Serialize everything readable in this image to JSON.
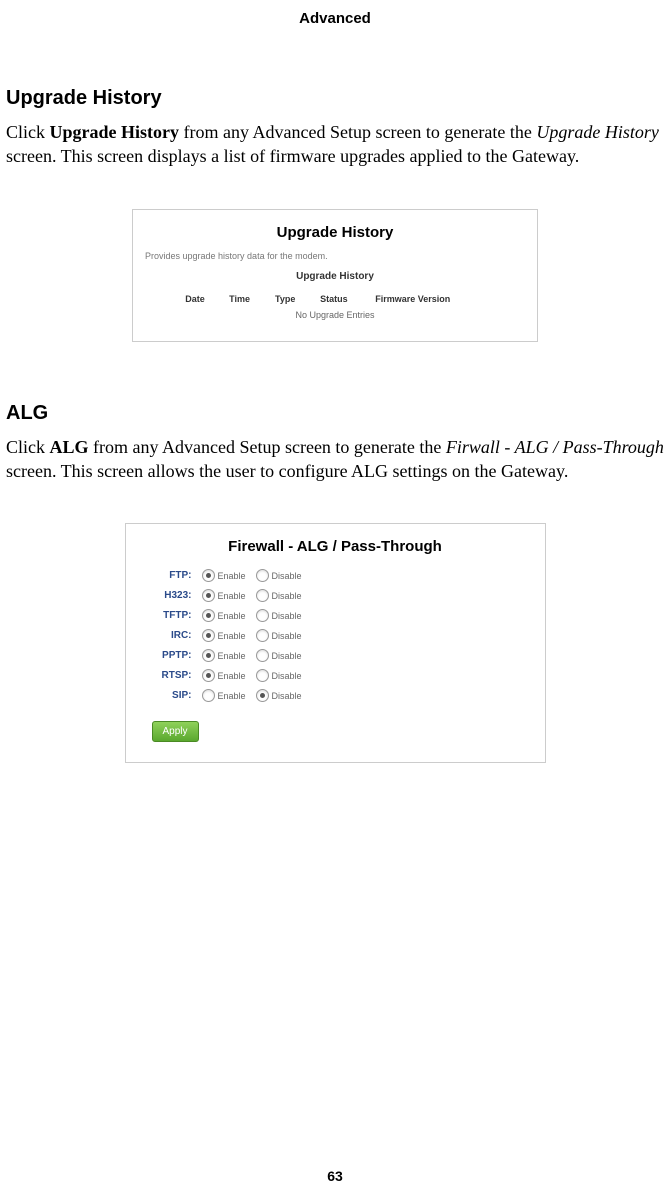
{
  "header": {
    "title": "Advanced"
  },
  "section1": {
    "heading": "Upgrade History",
    "para_pre": "Click ",
    "para_bold": "Upgrade History",
    "para_mid": " from any Advanced Setup screen to generate the ",
    "para_italic": "Upgrade History",
    "para_post": " screen. This screen displays a list of firmware upgrades applied to the Gateway."
  },
  "panel1": {
    "title": "Upgrade History",
    "desc": "Provides upgrade history data for the modem.",
    "subtitle": "Upgrade History",
    "cols": {
      "c1": "Date",
      "c2": "Time",
      "c3": "Type",
      "c4": "Status",
      "c5": "Firmware Version"
    },
    "empty": "No Upgrade Entries"
  },
  "section2": {
    "heading": "ALG",
    "para_pre": "Click ",
    "para_bold": "ALG",
    "para_mid": " from any Advanced Setup screen to generate the ",
    "para_italic": "Firwall - ALG / Pass-Through",
    "para_post": " screen. This screen allows the user to configure ALG settings on the Gateway."
  },
  "panel2": {
    "title": "Firewall - ALG / Pass-Through",
    "enable": "Enable",
    "disable": "Disable",
    "rows": {
      "r0": {
        "label": "FTP:",
        "sel": "enable"
      },
      "r1": {
        "label": "H323:",
        "sel": "enable"
      },
      "r2": {
        "label": "TFTP:",
        "sel": "enable"
      },
      "r3": {
        "label": "IRC:",
        "sel": "enable"
      },
      "r4": {
        "label": "PPTP:",
        "sel": "enable"
      },
      "r5": {
        "label": "RTSP:",
        "sel": "enable"
      },
      "r6": {
        "label": "SIP:",
        "sel": "disable"
      }
    },
    "apply": "Apply"
  },
  "footer": {
    "page": "63"
  }
}
